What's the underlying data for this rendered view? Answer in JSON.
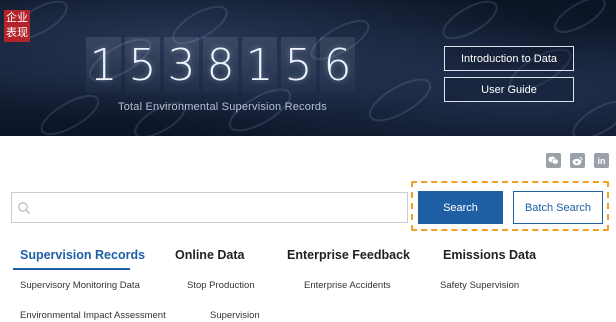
{
  "hero": {
    "tag": "企业表现",
    "digits": [
      "1",
      "5",
      "3",
      "8",
      "1",
      "5",
      "6"
    ],
    "counter_label": "Total Environmental Supervision Records",
    "buttons": {
      "intro": "Introduction to Data",
      "guide": "User Guide"
    }
  },
  "social": {
    "wechat": "wechat-icon",
    "weibo": "weibo-icon",
    "linkedin": "in"
  },
  "search": {
    "placeholder": "",
    "search_label": "Search",
    "batch_label": "Batch Search"
  },
  "tabs": [
    {
      "label": "Supervision Records"
    },
    {
      "label": "Online Data"
    },
    {
      "label": "Enterprise Feedback"
    },
    {
      "label": "Emissions Data"
    }
  ],
  "subitems": {
    "row1": [
      "Supervisory Monitoring Data",
      "Stop Production",
      "Enterprise Accidents",
      "Safety Supervision"
    ],
    "row2": [
      "Environmental Impact Assessment",
      "Supervision"
    ]
  },
  "colors": {
    "accent": "#1f5fa6",
    "highlight": "#f0a020",
    "tag": "#b3232b"
  }
}
